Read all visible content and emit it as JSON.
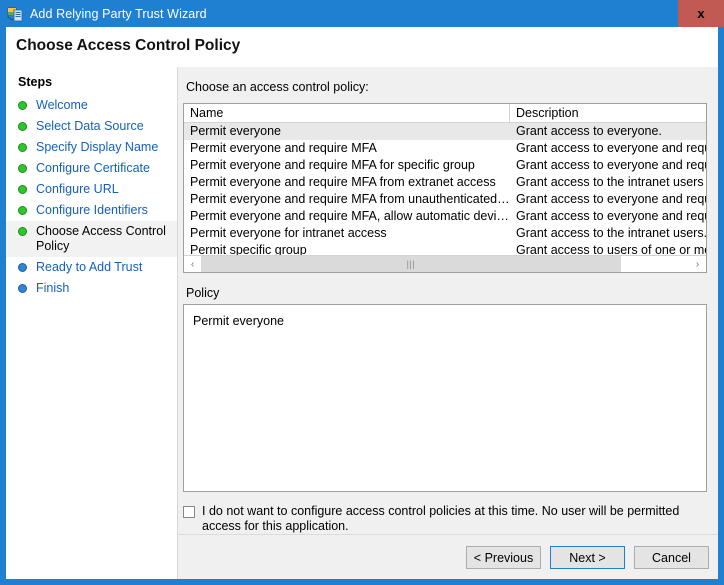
{
  "window": {
    "title": "Add Relying Party Trust Wizard",
    "icon": "adfs-shield-icon",
    "close_label": "x",
    "accent_color": "#1f7fd0",
    "close_color": "#c05a52"
  },
  "header": {
    "title": "Choose Access Control Policy"
  },
  "sidebar": {
    "heading": "Steps",
    "items": [
      {
        "label": "Welcome",
        "state": "done"
      },
      {
        "label": "Select Data Source",
        "state": "done"
      },
      {
        "label": "Specify Display Name",
        "state": "done"
      },
      {
        "label": "Configure Certificate",
        "state": "done"
      },
      {
        "label": "Configure URL",
        "state": "done"
      },
      {
        "label": "Configure Identifiers",
        "state": "done"
      },
      {
        "label": "Choose Access Control Policy",
        "state": "current"
      },
      {
        "label": "Ready to Add Trust",
        "state": "pending"
      },
      {
        "label": "Finish",
        "state": "pending"
      }
    ],
    "bullet_done_color": "#2dc72d",
    "bullet_pending_color": "#2f86d8",
    "link_color": "#1560bd"
  },
  "main": {
    "list_caption": "Choose an access control policy:",
    "columns": [
      "Name",
      "Description"
    ],
    "rows": [
      {
        "name": "Permit everyone",
        "description": "Grant access to everyone.",
        "selected": true
      },
      {
        "name": "Permit everyone and require MFA",
        "description": "Grant access to everyone and require M",
        "selected": false
      },
      {
        "name": "Permit everyone and require MFA for specific group",
        "description": "Grant access to everyone and require M",
        "selected": false
      },
      {
        "name": "Permit everyone and require MFA from extranet access",
        "description": "Grant access to the intranet users and re",
        "selected": false
      },
      {
        "name": "Permit everyone and require MFA from unauthenticated devices",
        "description": "Grant access to everyone and require M",
        "selected": false
      },
      {
        "name": "Permit everyone and require MFA, allow automatic device registr...",
        "description": "Grant access to everyone and require M",
        "selected": false
      },
      {
        "name": "Permit everyone for intranet access",
        "description": "Grant access to the intranet users.",
        "selected": false
      },
      {
        "name": "Permit specific group",
        "description": "Grant access to users of one or more sp",
        "selected": false
      }
    ],
    "scrollbar": {
      "left_arrow": "‹",
      "right_arrow": "›",
      "grip": "|||"
    },
    "policy_label": "Policy",
    "policy_text": "Permit everyone",
    "checkbox": {
      "checked": false,
      "label": "I do not want to configure access control policies at this time. No user will be permitted access for this application."
    }
  },
  "footer": {
    "previous_label": "< Previous",
    "next_label": "Next >",
    "cancel_label": "Cancel"
  }
}
